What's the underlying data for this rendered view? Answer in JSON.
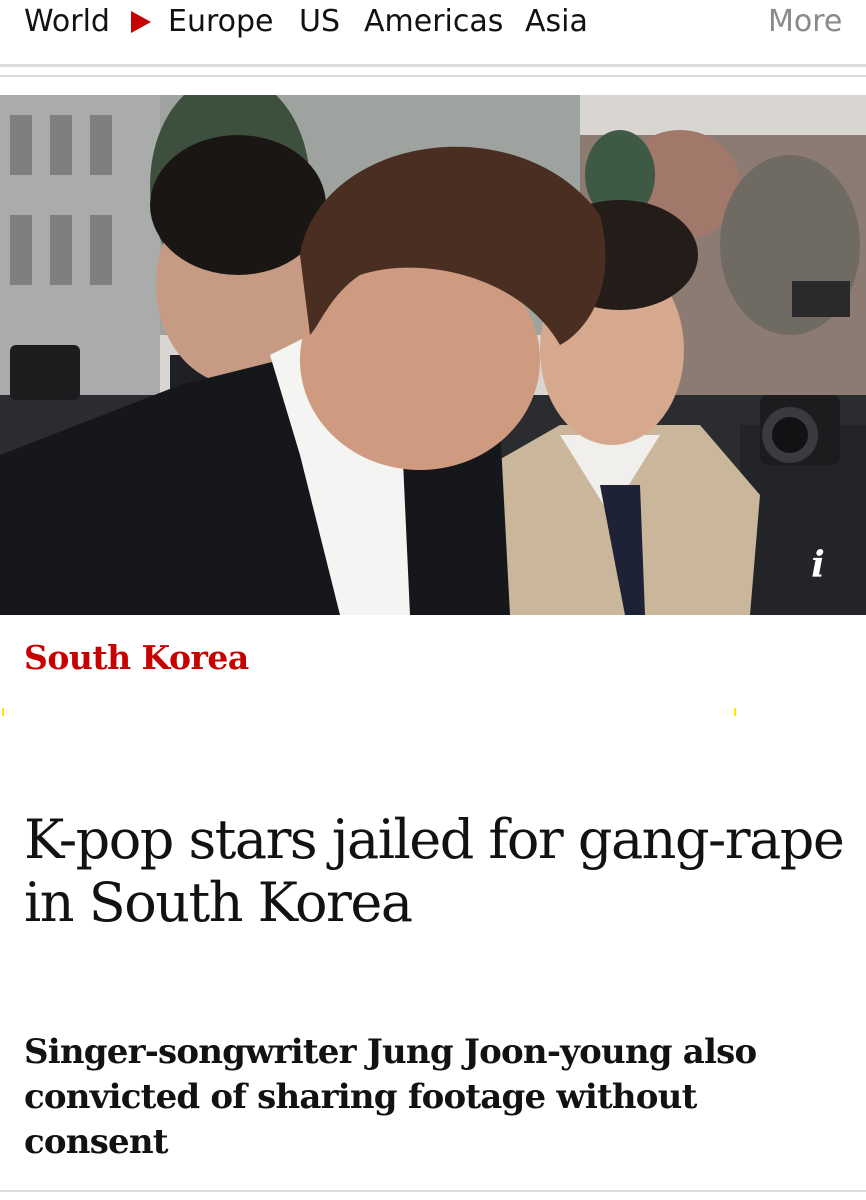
{
  "nav": {
    "items": [
      "World",
      "Europe",
      "US",
      "Americas",
      "Asia"
    ],
    "more_label": "More",
    "separator_icon": "play-triangle-icon",
    "arrow_color": "#c70000"
  },
  "hero": {
    "info_label": "i",
    "info_icon": "info-icon"
  },
  "article": {
    "kicker": "South Korea",
    "kicker_color": "#c70000",
    "headline": "K-pop stars jailed for gang-rape in South Korea",
    "standfirst": "Singer-songwriter Jung Joon-young also convicted of sharing footage without consent"
  }
}
